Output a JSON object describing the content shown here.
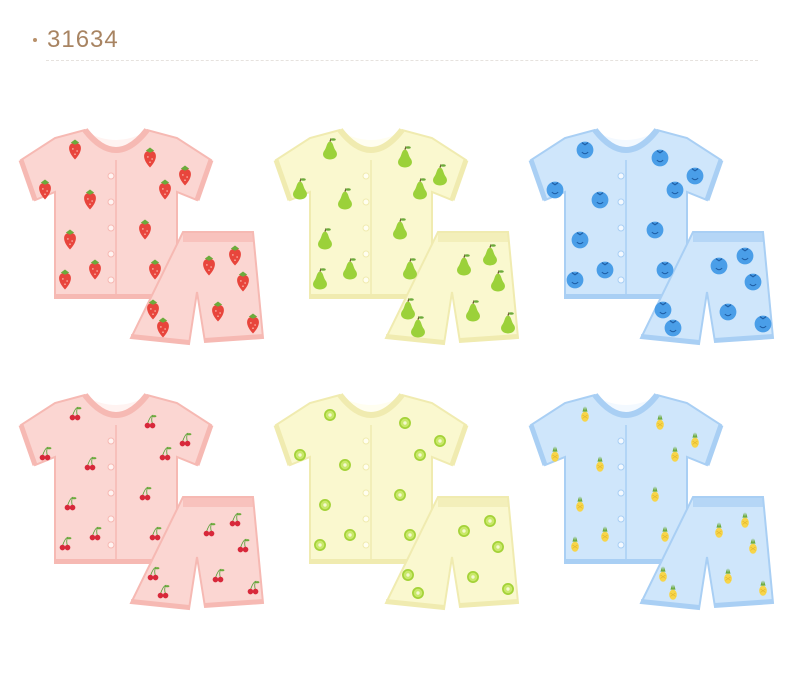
{
  "header": {
    "code": "31634"
  },
  "palette": {
    "pink": {
      "base": "#fbd6d2",
      "trim": "#f6b9b3",
      "inner": "#fff3f1"
    },
    "yellow": {
      "base": "#faf8cf",
      "trim": "#f0ebb0",
      "inner": "#fffef0"
    },
    "blue": {
      "base": "#cfe6fb",
      "trim": "#a9cff4",
      "inner": "#f3f9ff"
    }
  },
  "sets": [
    {
      "color": "pink",
      "pattern": "strawberry-icon"
    },
    {
      "color": "yellow",
      "pattern": "pear-icon"
    },
    {
      "color": "blue",
      "pattern": "blueberry-icon"
    },
    {
      "color": "pink",
      "pattern": "cherry-icon"
    },
    {
      "color": "yellow",
      "pattern": "kiwi-icon"
    },
    {
      "color": "blue",
      "pattern": "pineapple-icon"
    }
  ]
}
